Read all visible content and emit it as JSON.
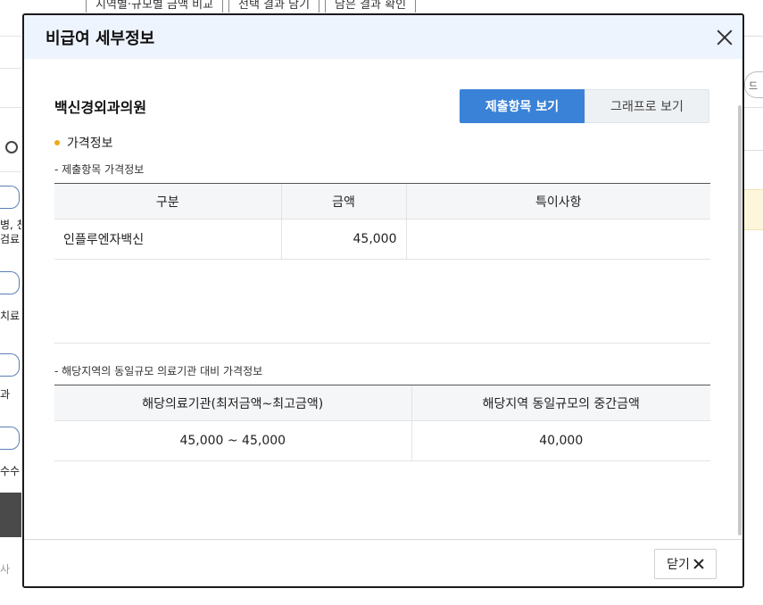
{
  "background": {
    "top_nav": [
      "지역별·규모별 금액 비교",
      "선택 결과 담기",
      "담은 결과 확인"
    ],
    "left_labels": [
      "병, 천",
      "검료",
      "치료",
      "과",
      "수수",
      "사"
    ],
    "right_button": "드"
  },
  "modal": {
    "title": "비급여 세부정보",
    "hospital_name": "백신경외과의원",
    "view_buttons": {
      "items": "제출항목 보기",
      "graph": "그래프로 보기"
    },
    "section_title": "가격정보",
    "submitted": {
      "subtitle": "- 제출항목 가격정보",
      "headers": [
        "구분",
        "금액",
        "특이사항"
      ],
      "rows": [
        {
          "name": "인플루엔자백신",
          "amount": "45,000",
          "note": ""
        }
      ]
    },
    "regional": {
      "subtitle": "- 해당지역의 동일규모 의료기관 대비 가격정보",
      "headers": [
        "해당의료기관(최저금액~최고금액)",
        "해당지역 동일규모의 중간금액"
      ],
      "rows": [
        {
          "range": "45,000 ~ 45,000",
          "median": "40,000"
        }
      ]
    },
    "footer": {
      "close_label": "닫기"
    }
  }
}
